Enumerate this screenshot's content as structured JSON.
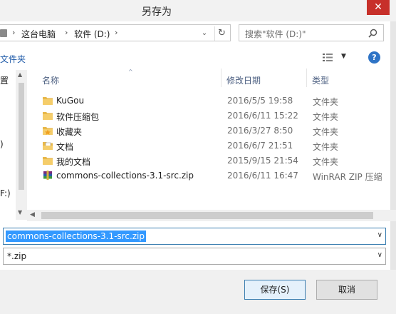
{
  "window": {
    "title": "另存为",
    "close_glyph": "✕"
  },
  "address": {
    "crumbs": [
      "这台电脑",
      "软件 (D:)"
    ],
    "separator": "›",
    "dropdown_glyph": "⌄",
    "refresh_glyph": "↻"
  },
  "search": {
    "placeholder": "搜索\"软件 (D:)\""
  },
  "toolbar": {
    "new_folder_partial": "文件夹",
    "view_dropdown_glyph": "▼",
    "help_glyph": "?"
  },
  "nav": {
    "items": [
      "置",
      ")",
      "F:)"
    ],
    "scroll_up_glyph": "▲",
    "scroll_down_glyph": "▼"
  },
  "columns": {
    "name": "名称",
    "date": "修改日期",
    "type": "类型",
    "sort_glyph": "^"
  },
  "files": [
    {
      "name": "KuGou",
      "date": "2016/5/5 19:58",
      "type": "文件夹",
      "icon": "folder-icon"
    },
    {
      "name": "软件压缩包",
      "date": "2016/6/11 15:22",
      "type": "文件夹",
      "icon": "folder-icon"
    },
    {
      "name": "收藏夹",
      "date": "2016/3/27 8:50",
      "type": "文件夹",
      "icon": "favorites-folder-icon"
    },
    {
      "name": "文档",
      "date": "2016/6/7 21:51",
      "type": "文件夹",
      "icon": "documents-folder-icon"
    },
    {
      "name": "我的文档",
      "date": "2015/9/15 21:54",
      "type": "文件夹",
      "icon": "folder-icon"
    },
    {
      "name": "commons-collections-3.1-src.zip",
      "date": "2016/6/11 16:47",
      "type": "WinRAR ZIP 压缩",
      "icon": "winrar-zip-icon"
    }
  ],
  "hscroll": {
    "left_glyph": "◀"
  },
  "filename": {
    "value": "commons-collections-3.1-src.zip",
    "dropdown_glyph": "∨"
  },
  "filetype": {
    "value": "*.zip",
    "dropdown_glyph": "∨"
  },
  "buttons": {
    "save": "保存(S)",
    "cancel": "取消"
  },
  "colors": {
    "accent": "#3399ff",
    "close": "#c7302a",
    "folder": "#e8b84a",
    "help": "#2f74c6"
  }
}
